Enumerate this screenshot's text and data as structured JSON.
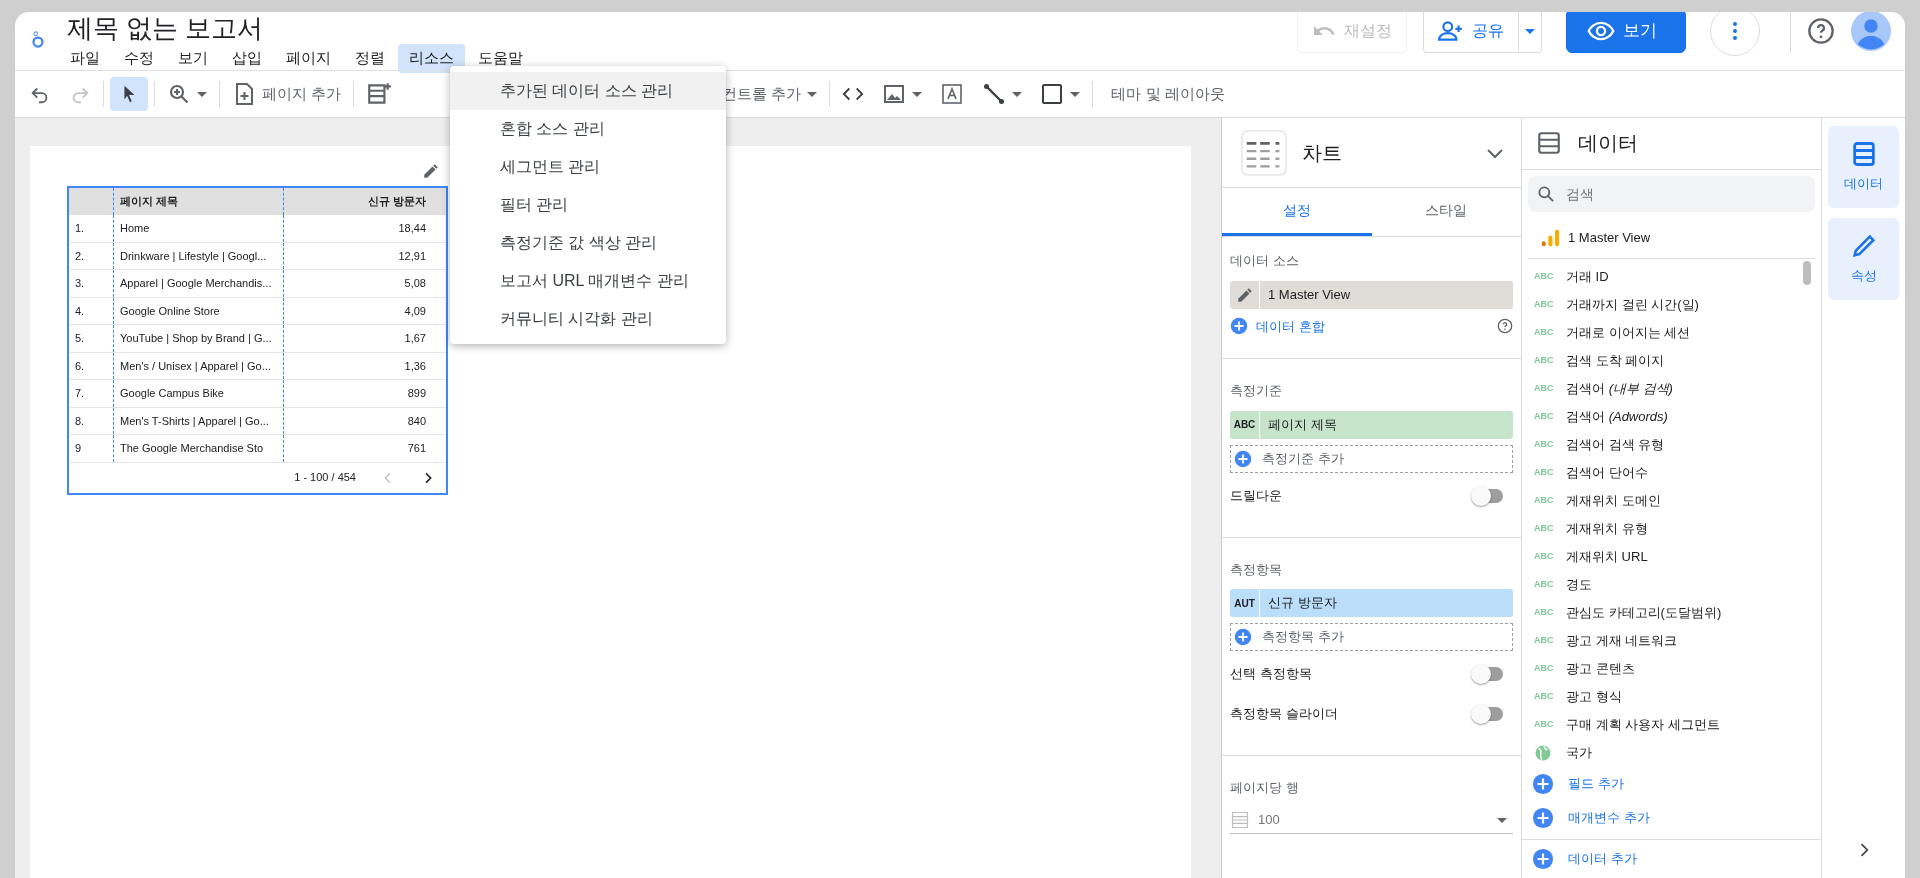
{
  "header": {
    "title": "제목 없는 보고서",
    "menu": [
      {
        "label": "파일",
        "selected": false
      },
      {
        "label": "수정",
        "selected": false
      },
      {
        "label": "보기",
        "selected": false
      },
      {
        "label": "삽입",
        "selected": false
      },
      {
        "label": "페이지",
        "selected": false
      },
      {
        "label": "정렬",
        "selected": false
      },
      {
        "label": "리소스",
        "selected": true
      },
      {
        "label": "도움말",
        "selected": false
      }
    ],
    "reset_button": {
      "label": "재설정",
      "disabled": true
    },
    "share_button": "공유",
    "view_button": "보기"
  },
  "toolbar": {
    "redo_disabled": true,
    "select_active": true,
    "add_page": "페이지 추가",
    "add_control": "컨트롤 추가",
    "theme_layout": "테마 및 레이아웃"
  },
  "dropdown_menu": [
    {
      "label": "추가된 데이터 소스 관리",
      "highlighted": true
    },
    {
      "label": "혼합 소스 관리",
      "highlighted": false
    },
    {
      "label": "세그먼트 관리",
      "highlighted": false
    },
    {
      "label": "필터 관리",
      "highlighted": false
    },
    {
      "label": "측정기준 값 색상 관리",
      "highlighted": false
    },
    {
      "label": "보고서 URL 매개변수 관리",
      "highlighted": false
    },
    {
      "label": "커뮤니티 시각화 관리",
      "highlighted": false
    }
  ],
  "table": {
    "columns": [
      "페이지 제목",
      "신규 방문자"
    ],
    "rows": [
      {
        "index": "1.",
        "title": "Home",
        "value": "18,44"
      },
      {
        "index": "2.",
        "title": "Drinkware | Lifestyle | Googl...",
        "value": "12,91"
      },
      {
        "index": "3.",
        "title": "Apparel | Google Merchandis...",
        "value": "5,08"
      },
      {
        "index": "4.",
        "title": "Google Online Store",
        "value": "4,09"
      },
      {
        "index": "5.",
        "title": "YouTube | Shop by Brand | G...",
        "value": "1,67"
      },
      {
        "index": "6.",
        "title": "Men's / Unisex | Apparel | Go...",
        "value": "1,36"
      },
      {
        "index": "7.",
        "title": "Google Campus Bike",
        "value": "899"
      },
      {
        "index": "8.",
        "title": "Men's T-Shirts | Apparel | Go...",
        "value": "840"
      },
      {
        "index": "9",
        "title": "The Google Merchandise Sto",
        "value": "761"
      }
    ],
    "pagination": "1 - 100 / 454"
  },
  "properties": {
    "chart_type": "차트",
    "tabs": [
      {
        "label": "설정",
        "selected": true
      },
      {
        "label": "스타일",
        "selected": false
      }
    ],
    "data_source": {
      "label": "데이터 소스",
      "source": "1 Master View",
      "blend": "데이터 혼합"
    },
    "sections": [
      {
        "kind": "dimension",
        "label": "측정기준",
        "chip_type": "ABC",
        "field": "페이지 제목",
        "add": "측정기준 추가",
        "toggles": [
          {
            "label": "드릴다운",
            "on": false
          }
        ]
      },
      {
        "kind": "metric",
        "label": "측정항목",
        "chip_type": "AUT",
        "field": "신규 방문자",
        "add": "측정항목 추가",
        "toggles": [
          {
            "label": "선택 측정항목",
            "on": false
          },
          {
            "label": "측정항목 슬라이더",
            "on": false
          }
        ]
      }
    ],
    "rows_per_page": {
      "label": "페이지당 행",
      "value": "100"
    }
  },
  "data_panel": {
    "title": "데이터",
    "search_placeholder": "검색",
    "source": "1 Master View",
    "fields": [
      {
        "kind": "text",
        "type_label": "ABC",
        "name": "거래 ID"
      },
      {
        "kind": "text",
        "type_label": "ABC",
        "name": "거래까지 걸린 시간(일)"
      },
      {
        "kind": "text",
        "type_label": "ABC",
        "name": "거래로 이어지는 세션"
      },
      {
        "kind": "text",
        "type_label": "ABC",
        "name": "검색 도착 페이지"
      },
      {
        "kind": "text",
        "type_label": "ABC",
        "name": "검색어 *(내부 검색)*"
      },
      {
        "kind": "text",
        "type_label": "ABC",
        "name": "검색어 *(Adwords)*"
      },
      {
        "kind": "text",
        "type_label": "ABC",
        "name": "검색어 검색 유형"
      },
      {
        "kind": "text",
        "type_label": "ABC",
        "name": "검색어 단어수"
      },
      {
        "kind": "text",
        "type_label": "ABC",
        "name": "게재위치 도메인"
      },
      {
        "kind": "text",
        "type_label": "ABC",
        "name": "게재위치 유형"
      },
      {
        "kind": "text",
        "type_label": "ABC",
        "name": "게재위치 URL"
      },
      {
        "kind": "text",
        "type_label": "ABC",
        "name": "경도"
      },
      {
        "kind": "text",
        "type_label": "ABC",
        "name": "관심도 카테고리(도달범위)"
      },
      {
        "kind": "text",
        "type_label": "ABC",
        "name": "광고 게재 네트워크"
      },
      {
        "kind": "text",
        "type_label": "ABC",
        "name": "광고 콘텐츠"
      },
      {
        "kind": "text",
        "type_label": "ABC",
        "name": "광고 형식"
      },
      {
        "kind": "text",
        "type_label": "ABC",
        "name": "구매 계획 사용자 세그먼트"
      },
      {
        "kind": "geo",
        "name": "국가"
      }
    ],
    "add_field": "필드 추가",
    "add_parameter": "매개변수 추가",
    "add_data": "데이터 추가"
  },
  "rail": [
    {
      "label": "데이터",
      "kind": "data",
      "active": true
    },
    {
      "label": "속성",
      "kind": "properties",
      "active": true
    }
  ]
}
